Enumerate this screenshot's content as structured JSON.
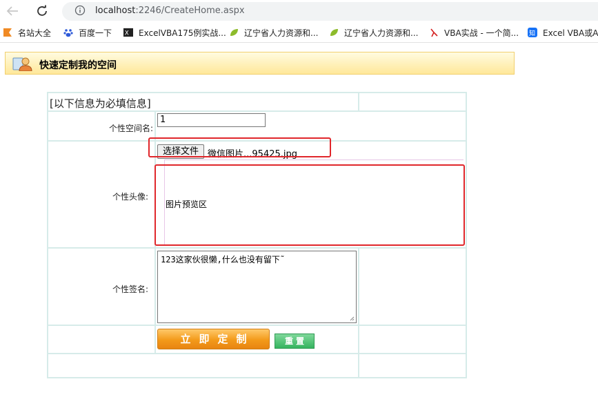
{
  "browser": {
    "url_host": "localhost",
    "url_path": ":2246/CreateHome.aspx",
    "bookmarks": [
      {
        "label": "名站大全",
        "icon": "bookmark-flag-icon"
      },
      {
        "label": "百度一下",
        "icon": "baidu-paw-icon"
      },
      {
        "label": "ExcelVBA175例实战...",
        "icon": "excel-icon"
      },
      {
        "label": "辽宁省人力资源和...",
        "icon": "leaf-icon"
      },
      {
        "label": "辽宁省人力资源和...",
        "icon": "leaf-icon"
      },
      {
        "label": "VBA实战 - 一个简...",
        "icon": "vba-red-icon"
      },
      {
        "label": "Excel VBA或Ac",
        "icon": "zhihu-icon"
      }
    ]
  },
  "header": {
    "title": "快速定制我的空间"
  },
  "form": {
    "required_note": "[以下信息为必填信息]",
    "name_label": "个性空间名:",
    "name_value": "1",
    "avatar_label": "个性头像:",
    "file_button": "选择文件",
    "file_name": "微信图片...95425.jpg",
    "preview_text": "图片预览区",
    "signature_label": "个性签名:",
    "signature_value": "123这家伙很懒,什么也没有留下˜",
    "submit_label": "立即定制",
    "reset_label": "重置"
  },
  "colors": {
    "accent_red": "#e0262b",
    "header_bg": "#ffe89a",
    "grid_line": "#d6ebe9",
    "submit_orange": "#f39a1a",
    "reset_green": "#35b45e"
  }
}
